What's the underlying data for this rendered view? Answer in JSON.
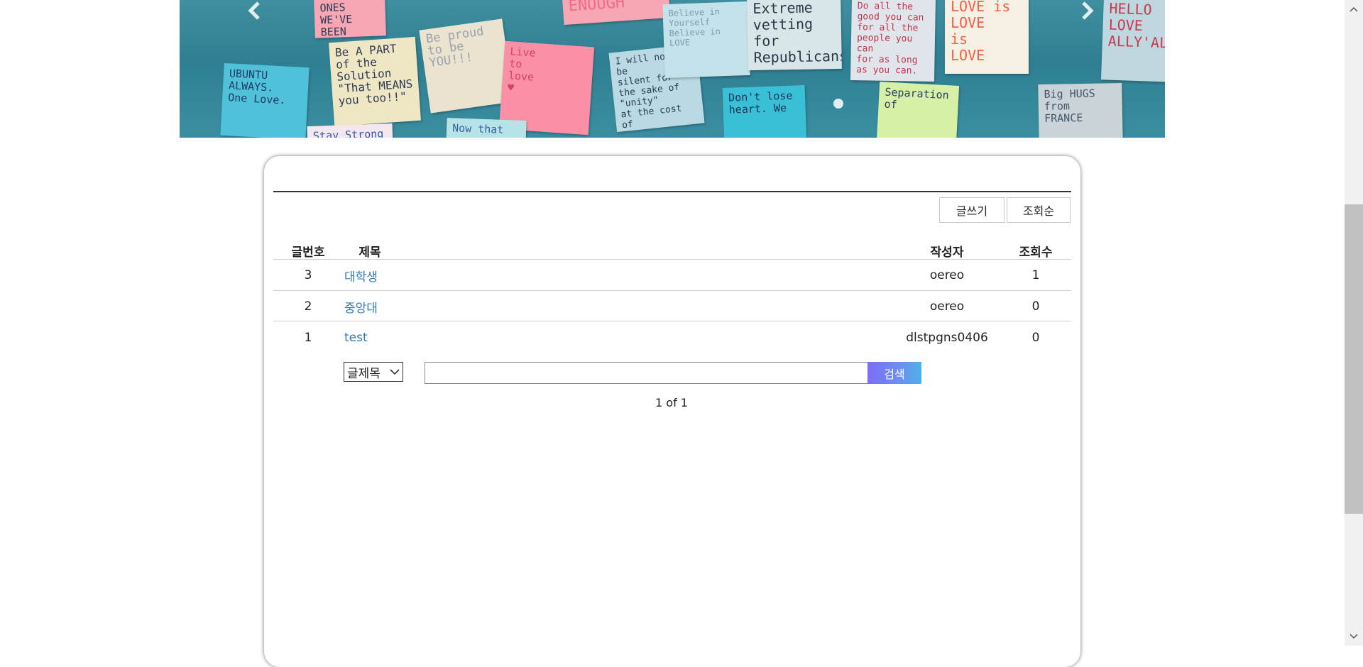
{
  "carousel": {
    "prev_icon": "chevron-left-icon",
    "next_icon": "chevron-right-icon",
    "notes": [
      "ONES WE'VE\nBEEN\nWAITING FOR.",
      "Be A PART\nof the\nSolution\n\"That MEANS\nyou too!!\"",
      "UBUNTU\nALWAYS.\nOne Love.",
      "Be proud\nto be\nYOU!!!",
      "Live\nto\nlove\n♥",
      "ENOUGH",
      "I will not\nbe\nsilent for\nthe sake of \"unity\"\nat the cost of\nwhat's right!",
      "Believe in\nYourself\nBelieve in\nLOVE",
      "Extreme\nvetting\nfor\nRepublicans.",
      "Do all the\ngood you can\nfor all the\npeople you can\nfor as long\nas you can.",
      "Don't lose\nheart. We",
      "Separation\nof",
      "LOVE is\nLOVE\nis\nLOVE",
      "Big HUGS\nfrom\nFRANCE",
      "HELLO\nLOVE\nALLY'ALL",
      "Stay Strong",
      "Now that"
    ]
  },
  "toolbar": {
    "write_label": "글쓰기",
    "sort_views_label": "조회순"
  },
  "table": {
    "headers": {
      "no": "글번호",
      "title": "제목",
      "author": "작성자",
      "views": "조회수"
    },
    "rows": [
      {
        "no": "3",
        "title": "대학생",
        "author": "oereo",
        "views": "1"
      },
      {
        "no": "2",
        "title": "중앙대",
        "author": "oereo",
        "views": "0"
      },
      {
        "no": "1",
        "title": "test",
        "author": "dlstpgns0406",
        "views": "0"
      }
    ]
  },
  "search": {
    "field_selected": "글제목",
    "query": "",
    "button_label": "검색"
  },
  "pagination": {
    "text": "1 of 1"
  },
  "colors": {
    "link": "#337ab7",
    "search_button_start": "#7b6ef6",
    "search_button_end": "#4fb0e8"
  }
}
